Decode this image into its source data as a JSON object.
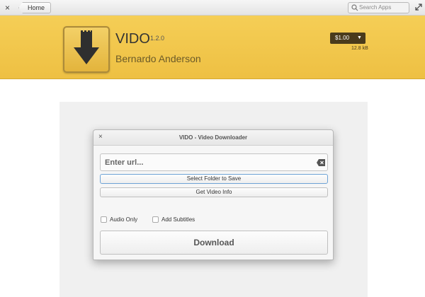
{
  "header": {
    "home_label": "Home",
    "search_placeholder": "Search Apps"
  },
  "app": {
    "name": "VIDO",
    "version": "1.2.0",
    "author": "Bernardo Anderson",
    "price": "$1.00",
    "size": "12.8 kB",
    "banner_color": "#f2c64e"
  },
  "window": {
    "title": "VIDO - Video Downloader",
    "url_placeholder": "Enter url...",
    "select_folder_label": "Select Folder to Save",
    "video_info_label": "Get Video Info",
    "audio_only_label": "Audio Only",
    "subtitles_label": "Add Subtitles",
    "download_label": "Download"
  }
}
